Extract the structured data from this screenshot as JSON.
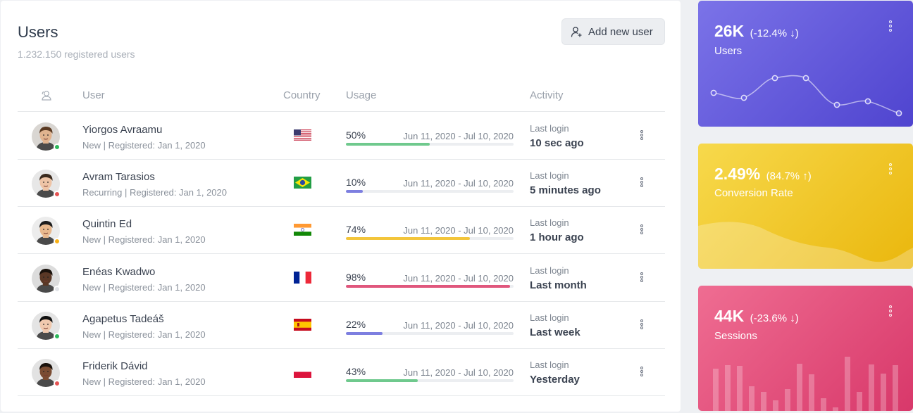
{
  "header": {
    "title": "Users",
    "subtitle": "1.232.150 registered users",
    "add_button": "Add new user"
  },
  "table": {
    "columns": {
      "user": "User",
      "country": "Country",
      "usage": "Usage",
      "activity": "Activity"
    },
    "rows": [
      {
        "name": "Yiorgos Avraamu",
        "meta": "New | Registered: Jan 1, 2020",
        "status": "#2eb85c",
        "country": "USA",
        "usage_pct": "50%",
        "usage_value": 0.5,
        "usage_color": "#6fc98d",
        "period": "Jun 11, 2020 - Jul 10, 2020",
        "activity_label": "Last login",
        "activity": "10 sec ago",
        "skin": "#e0b38f",
        "hair": "#5a3a22"
      },
      {
        "name": "Avram Tarasios",
        "meta": "Recurring | Registered: Jan 1, 2020",
        "status": "#e55353",
        "country": "Brazil",
        "usage_pct": "10%",
        "usage_value": 0.1,
        "usage_color": "#7d7fe0",
        "period": "Jun 11, 2020 - Jul 10, 2020",
        "activity_label": "Last login",
        "activity": "5 minutes ago",
        "skin": "#eec4a6",
        "hair": "#3a2a1e"
      },
      {
        "name": "Quintin Ed",
        "meta": "New | Registered: Jan 1, 2020",
        "status": "#f9b115",
        "country": "India",
        "usage_pct": "74%",
        "usage_value": 0.74,
        "usage_color": "#f3c53b",
        "period": "Jun 11, 2020 - Jul 10, 2020",
        "activity_label": "Last login",
        "activity": "1 hour ago",
        "skin": "#e9b98e",
        "hair": "#1d1d1d"
      },
      {
        "name": "Enéas Kwadwo",
        "meta": "New | Registered: Jan 1, 2020",
        "status": "#e2e4e8",
        "country": "France",
        "usage_pct": "98%",
        "usage_value": 0.98,
        "usage_color": "#e0577d",
        "period": "Jun 11, 2020 - Jul 10, 2020",
        "activity_label": "Last login",
        "activity": "Last month",
        "skin": "#5a3826",
        "hair": "#1a120c"
      },
      {
        "name": "Agapetus Tadeáš",
        "meta": "New | Registered: Jan 1, 2020",
        "status": "#2eb85c",
        "country": "Spain",
        "usage_pct": "22%",
        "usage_value": 0.22,
        "usage_color": "#7d7fe0",
        "period": "Jun 11, 2020 - Jul 10, 2020",
        "activity_label": "Last login",
        "activity": "Last week",
        "skin": "#f0c9ae",
        "hair": "#111111"
      },
      {
        "name": "Friderik Dávid",
        "meta": "New | Registered: Jan 1, 2020",
        "status": "#e55353",
        "country": "Poland",
        "usage_pct": "43%",
        "usage_value": 0.43,
        "usage_color": "#6fc98d",
        "period": "Jun 11, 2020 - Jul 10, 2020",
        "activity_label": "Last login",
        "activity": "Yesterday",
        "skin": "#7a4c32",
        "hair": "#1a120c"
      }
    ]
  },
  "stats": [
    {
      "value": "26K",
      "change": "(-12.4% ↓)",
      "label": "Users",
      "bg_from": "#7b73e8",
      "bg_to": "#4f44cf"
    },
    {
      "value": "2.49%",
      "change": "(84.7% ↑)",
      "label": "Conversion Rate",
      "bg_from": "#f7d94c",
      "bg_to": "#eab70d"
    },
    {
      "value": "44K",
      "change": "(-23.6% ↓)",
      "label": "Sessions",
      "bg_from": "#ef6d92",
      "bg_to": "#d8386a"
    }
  ],
  "colors": {
    "accent_green": "#2eb85c",
    "accent_red": "#e55353",
    "accent_yellow": "#f9b115"
  }
}
